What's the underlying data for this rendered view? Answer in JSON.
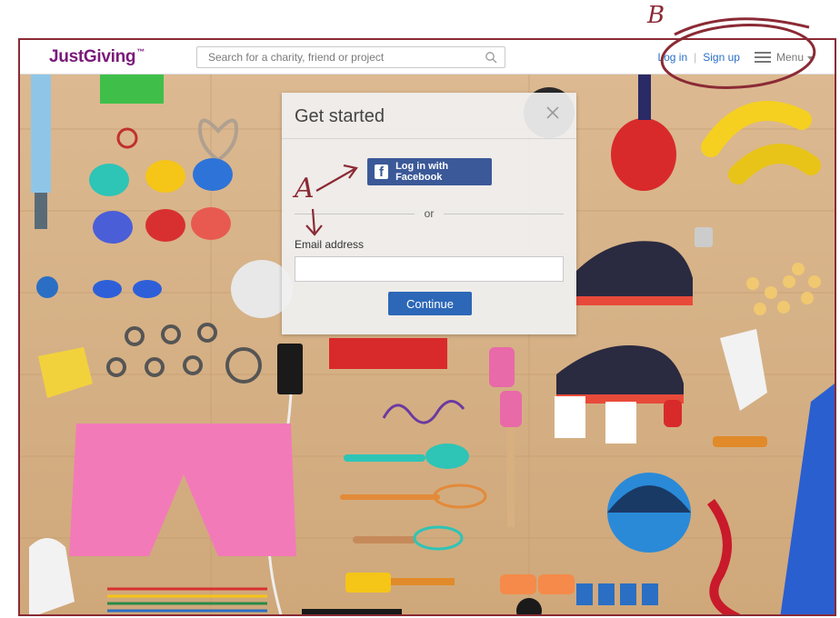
{
  "header": {
    "logo": "JustGiving",
    "logo_mark": "™",
    "search": {
      "placeholder": "Search for a charity, friend or project",
      "value": ""
    },
    "login_label": "Log in",
    "separator": "|",
    "signup_label": "Sign up",
    "menu_label": "Menu"
  },
  "modal": {
    "title": "Get started",
    "facebook_label": "Log in with Facebook",
    "or_label": "or",
    "email_label": "Email address",
    "email_value": "",
    "continue_label": "Continue"
  },
  "annotations": {
    "a": "A",
    "b": "B"
  },
  "colors": {
    "brand": "#7a1a7a",
    "facebook": "#3b5998",
    "link": "#2a6fc4",
    "primary_button": "#2c67b8",
    "annotation": "#8b2a35"
  }
}
